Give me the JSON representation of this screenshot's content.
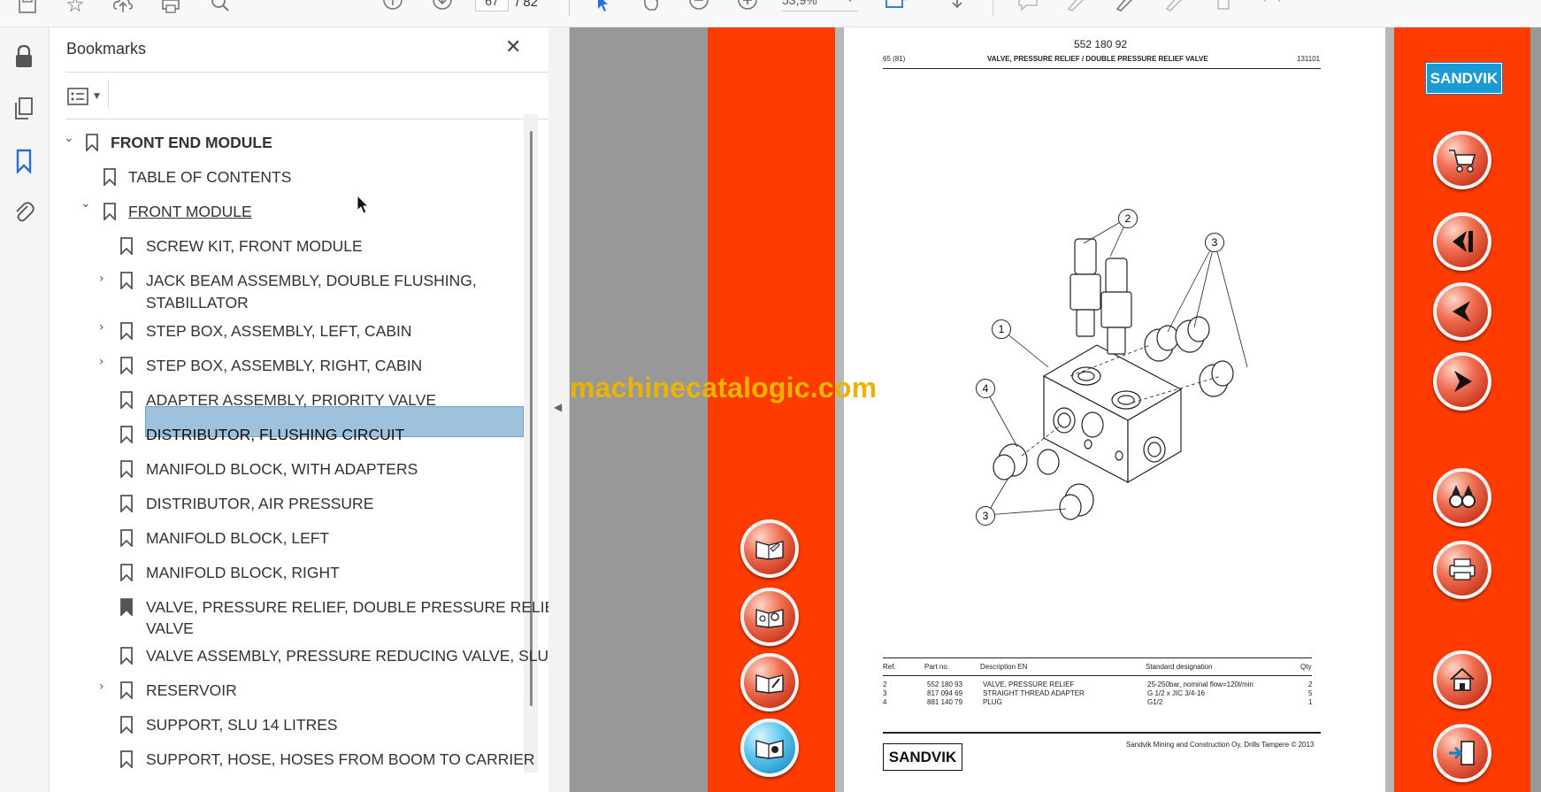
{
  "toolbar": {
    "page_current": "67",
    "page_total": "/ 82",
    "zoom": "53,9%"
  },
  "bookmarks": {
    "title": "Bookmarks",
    "items": [
      {
        "label": "FRONT END MODULE"
      },
      {
        "label": "TABLE OF CONTENTS"
      },
      {
        "label": "FRONT MODULE"
      },
      {
        "label": "SCREW KIT, FRONT MODULE"
      },
      {
        "label": "JACK BEAM ASSEMBLY, DOUBLE FLUSHING,",
        "label2": "STABILLATOR"
      },
      {
        "label": "STEP BOX, ASSEMBLY, LEFT, CABIN"
      },
      {
        "label": "STEP BOX, ASSEMBLY, RIGHT, CABIN"
      },
      {
        "label": "ADAPTER ASSEMBLY, PRIORITY VALVE"
      },
      {
        "label": "DISTRIBUTOR, FLUSHING CIRCUIT"
      },
      {
        "label": "MANIFOLD BLOCK, WITH ADAPTERS"
      },
      {
        "label": "DISTRIBUTOR, AIR PRESSURE"
      },
      {
        "label": "MANIFOLD BLOCK, LEFT"
      },
      {
        "label": "MANIFOLD BLOCK, RIGHT"
      },
      {
        "label": "VALVE, PRESSURE RELIEF, DOUBLE PRESSURE RELIEF",
        "label2": "VALVE"
      },
      {
        "label": "VALVE ASSEMBLY, PRESSURE REDUCING VALVE, SLU"
      },
      {
        "label": "RESERVOIR"
      },
      {
        "label": "SUPPORT, SLU 14 LITRES"
      },
      {
        "label": "SUPPORT, HOSE, HOSES FROM BOOM TO CARRIER"
      }
    ]
  },
  "watermark": "machinecatalogic.com",
  "document": {
    "part_number": "552 180 92",
    "page_ref": "65 (81)",
    "heading": "VALVE, PRESSURE RELIEF / DOUBLE PRESSURE RELIEF VALVE",
    "doc_code": "131101",
    "callouts": [
      "1",
      "2",
      "3",
      "4",
      "3"
    ],
    "table": {
      "headers": [
        "Ref.",
        "Part no.",
        "Description EN",
        "Standard designation",
        "Qty"
      ],
      "rows": [
        [
          "2",
          "552 180 93",
          "VALVE, PRESSURE RELIEF",
          "25-250bar, nominal flow=120l/min",
          "2"
        ],
        [
          "3",
          "817 094 69",
          "STRAIGHT THREAD ADAPTER",
          "G 1/2 x JIC 3/4-16",
          "5"
        ],
        [
          "4",
          "881 140 79",
          "PLUG",
          "G1/2",
          "1"
        ]
      ]
    },
    "footer_company": "Sandvik Mining and Construction Oy, Drills Tampere © 2013",
    "logo_text": "SANDVIK"
  },
  "colors": {
    "accent_red": "#ff3b00",
    "selection": "#9ec1de",
    "sandvik_blue": "#1b9ad6"
  }
}
